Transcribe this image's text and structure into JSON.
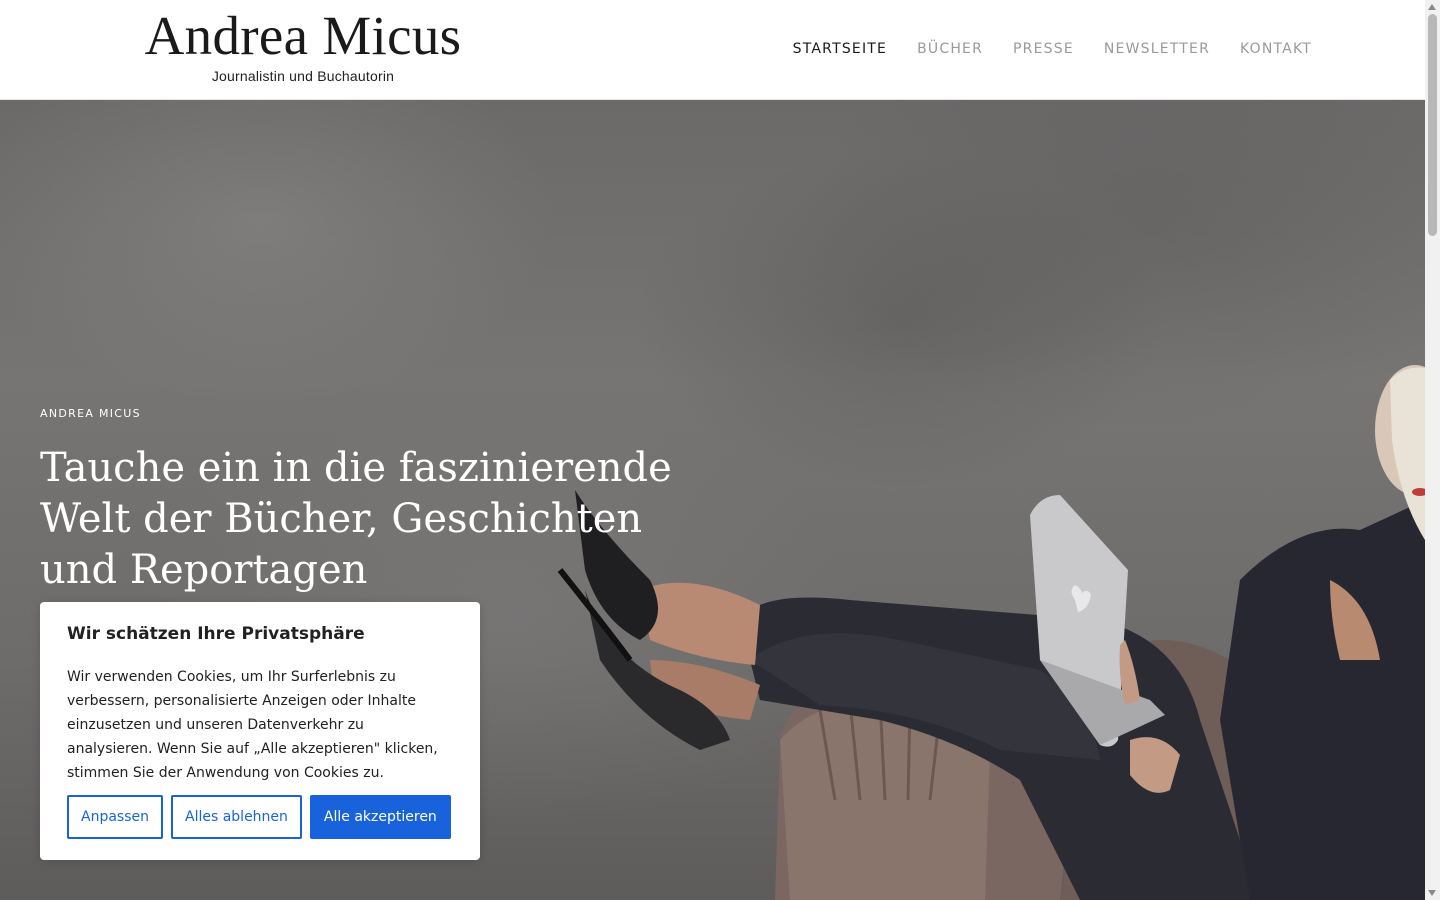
{
  "header": {
    "logo_title": "Andrea Micus",
    "logo_subtitle": "Journalistin und Buchautorin",
    "nav": [
      {
        "label": "STARTSEITE",
        "active": true
      },
      {
        "label": "BÜCHER",
        "active": false
      },
      {
        "label": "PRESSE",
        "active": false
      },
      {
        "label": "NEWSLETTER",
        "active": false
      },
      {
        "label": "KONTAKT",
        "active": false
      }
    ]
  },
  "hero": {
    "eyebrow": "ANDREA MICUS",
    "headline_lines": [
      "Tauche ein in die faszinierende",
      "Welt der Bücher, Geschichten",
      "und Reportagen"
    ]
  },
  "cookie_banner": {
    "title": "Wir schätzen Ihre Privatsphäre",
    "text": "Wir verwenden Cookies, um Ihr Surferlebnis zu verbessern, personalisierte Anzeigen oder Inhalte einzusetzen und unseren Datenverkehr zu analysieren. Wenn Sie auf „Alle akzeptieren\" klicken, stimmen Sie der Anwendung von Cookies zu.",
    "buttons": {
      "customize": "Anpassen",
      "reject_all": "Alles ablehnen",
      "accept_all": "Alle akzeptieren"
    }
  },
  "colors": {
    "accent": "#1863dc",
    "nav_inactive": "#9a9a9a",
    "nav_active": "#1a1a1a"
  }
}
